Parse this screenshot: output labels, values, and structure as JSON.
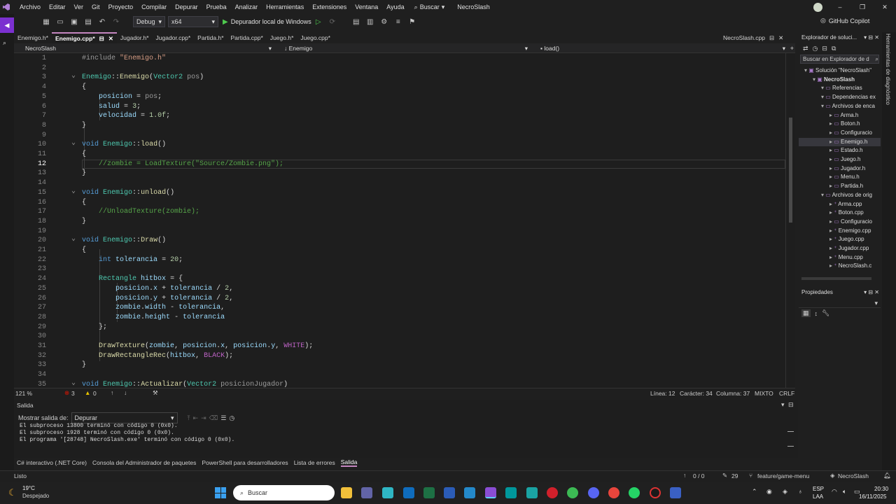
{
  "menu": [
    "Archivo",
    "Editar",
    "Ver",
    "Git",
    "Proyecto",
    "Compilar",
    "Depurar",
    "Prueba",
    "Analizar",
    "Herramientas",
    "Extensiones",
    "Ventana",
    "Ayuda"
  ],
  "search_label": "Buscar",
  "solution_title": "NecroSlash",
  "copilot": "GitHub Copilot",
  "toolbar": {
    "config": "Debug",
    "platform": "x64",
    "run_label": "Depurador local de Windows"
  },
  "tabs": [
    {
      "label": "Enemigo.h*",
      "active": false
    },
    {
      "label": "Enemigo.cpp*",
      "active": true
    },
    {
      "label": "Jugador.h*",
      "active": false
    },
    {
      "label": "Jugador.cpp*",
      "active": false
    },
    {
      "label": "Partida.h*",
      "active": false
    },
    {
      "label": "Partida.cpp*",
      "active": false
    },
    {
      "label": "Juego.h*",
      "active": false
    },
    {
      "label": "Juego.cpp*",
      "active": false
    }
  ],
  "right_tab": "NecroSlash.cpp",
  "nav": {
    "project": "NecroSlash",
    "scope": "Enemigo",
    "member": "load()"
  },
  "lines": [
    "1",
    "2",
    "3",
    "4",
    "5",
    "6",
    "7",
    "8",
    "9",
    "10",
    "11",
    "12",
    "13",
    "14",
    "15",
    "16",
    "17",
    "18",
    "19",
    "20",
    "21",
    "22",
    "23",
    "24",
    "25",
    "26",
    "27",
    "28",
    "29",
    "30",
    "31",
    "32",
    "33",
    "34",
    "35"
  ],
  "current_line": 12,
  "editor_status": {
    "zoom": "121 %",
    "errors": "3",
    "warnings": "0",
    "line": "Línea: 12",
    "char": "Carácter: 34",
    "col": "Columna: 37",
    "tabs": "MIXTO",
    "eol": "CRLF"
  },
  "output": {
    "title": "Salida",
    "show_label": "Mostrar salida de:",
    "source": "Depurar",
    "lines": [
      "El subproceso 13800 terminó con código 0 (0x0).",
      "El subproceso 1928 terminó con código 0 (0x0).",
      "El programa '[28748] NecroSlash.exe' terminó con código 0 (0x0)."
    ]
  },
  "bottom_tabs": [
    "C# interactivo (.NET Core)",
    "Consola del Administrador de paquetes",
    "PowerShell para desarrolladores",
    "Lista de errores",
    "Salida"
  ],
  "status": {
    "ready": "Listo",
    "counter": "0 / 0",
    "pencil": "29",
    "branch": "feature/game-menu",
    "repo": "NecroSlash"
  },
  "solution_explorer": {
    "title": "Explorador de soluci...",
    "search_placeholder": "Buscar en Explorador de d",
    "items": [
      {
        "label": "Solución \"NecroSlash\"",
        "level": 0,
        "sel": false
      },
      {
        "label": "NecroSlash",
        "level": 1,
        "sel": false,
        "bold": true
      },
      {
        "label": "Referencias",
        "level": 2,
        "sel": false
      },
      {
        "label": "Dependencias ex",
        "level": 2,
        "sel": false
      },
      {
        "label": "Archivos de enca",
        "level": 2,
        "sel": false
      },
      {
        "label": "Arma.h",
        "level": 3,
        "sel": false
      },
      {
        "label": "Boton.h",
        "level": 3,
        "sel": false
      },
      {
        "label": "Configuracio",
        "level": 3,
        "sel": false
      },
      {
        "label": "Enemigo.h",
        "level": 3,
        "sel": true
      },
      {
        "label": "Estado.h",
        "level": 3,
        "sel": false
      },
      {
        "label": "Juego.h",
        "level": 3,
        "sel": false
      },
      {
        "label": "Jugador.h",
        "level": 3,
        "sel": false
      },
      {
        "label": "Menu.h",
        "level": 3,
        "sel": false
      },
      {
        "label": "Partida.h",
        "level": 3,
        "sel": false
      },
      {
        "label": "Archivos de orig",
        "level": 2,
        "sel": false
      },
      {
        "label": "Arma.cpp",
        "level": 3,
        "sel": false
      },
      {
        "label": "Boton.cpp",
        "level": 3,
        "sel": false
      },
      {
        "label": "Configuracio",
        "level": 3,
        "sel": false
      },
      {
        "label": "Enemigo.cpp",
        "level": 3,
        "sel": false
      },
      {
        "label": "Juego.cpp",
        "level": 3,
        "sel": false
      },
      {
        "label": "Jugador.cpp",
        "level": 3,
        "sel": false
      },
      {
        "label": "Menu.cpp",
        "level": 3,
        "sel": false
      },
      {
        "label": "NecroSlash.c",
        "level": 3,
        "sel": false
      }
    ]
  },
  "properties_title": "Propiedades",
  "diagnostics_label": "Herramientas de diagnóstico",
  "taskbar": {
    "temp": "19°C",
    "weather": "Despejado",
    "search": "Buscar",
    "lang": "ESP",
    "lang2": "LAA",
    "time": "20:30",
    "date": "16/11/2025"
  },
  "colors": {
    "accent": "#7b30d0",
    "keyword": "#569cd6",
    "type": "#4ec9b0",
    "function": "#dcdcaa",
    "string": "#d69d85",
    "comment": "#57a64a",
    "number": "#b5cea8",
    "variable": "#9cdcfe"
  }
}
